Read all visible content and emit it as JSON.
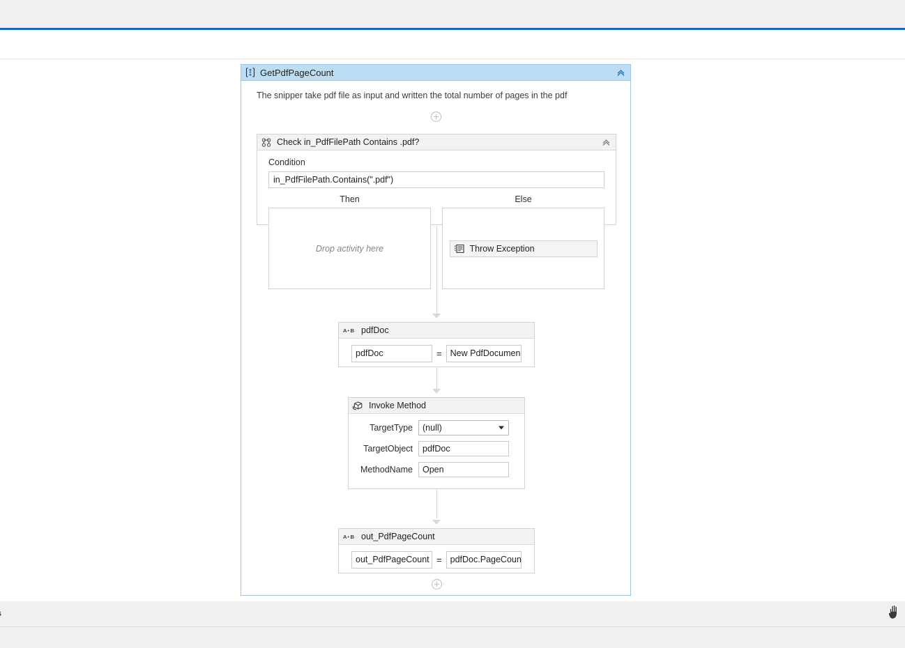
{
  "window": {
    "accent_color": "#1569b8",
    "canvas_background": "#ffffff"
  },
  "workflow": {
    "root": {
      "icon": "sequence-icon",
      "title": "GetPdfPageCount",
      "header_color": "#bcddf2",
      "border_color": "#9cc5e8",
      "collapse_icon": "chevron-double-up-icon",
      "description": "The snipper take pdf file as input and written the total number of pages in the pdf",
      "add_icon": "plus-circle-icon"
    },
    "if_activity": {
      "icon": "flow-decision-icon",
      "title": "Check in_PdfFilePath Contains .pdf?",
      "collapse_icon": "chevron-double-up-icon",
      "condition_label": "Condition",
      "condition_value": "in_PdfFilePath.Contains(\".pdf\")",
      "then_label": "Then",
      "else_label": "Else",
      "then_placeholder": "Drop activity here",
      "else_activity": {
        "icon": "throw-exception-icon",
        "title": "Throw Exception"
      }
    },
    "assign_pdfdoc": {
      "icon": "assign-icon",
      "icon_text": "A→B",
      "title": "pdfDoc",
      "to_value": "pdfDoc",
      "operator": "=",
      "expression_value": "New PdfDocumen"
    },
    "invoke_method": {
      "icon": "invoke-method-icon",
      "title": "Invoke Method",
      "fields": [
        {
          "label": "TargetType",
          "value": "(null)",
          "control": "combobox",
          "arrow_icon": "caret-down-icon"
        },
        {
          "label": "TargetObject",
          "value": "pdfDoc",
          "control": "textbox"
        },
        {
          "label": "MethodName",
          "value": "Open",
          "control": "textbox"
        }
      ]
    },
    "assign_pagecount": {
      "icon": "assign-icon",
      "icon_text": "A→B",
      "title": "out_PdfPageCount",
      "to_value": "out_PdfPageCount",
      "operator": "=",
      "expression_value": "pdfDoc.PageCoun"
    },
    "bottom_add_icon": "plus-circle-icon"
  },
  "statusbar": {
    "text": "s"
  },
  "cursor": {
    "icon": "pan-hand-cursor"
  }
}
